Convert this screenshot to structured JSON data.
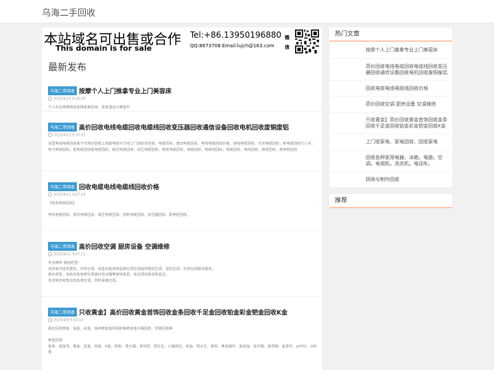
{
  "site": {
    "title": "乌海二手回收"
  },
  "banner": {
    "cn": "本站域名可出售或合作",
    "en": "This domain is for sale",
    "tel": "Tel:+86.13950196880",
    "contact": "QQ:8673708 Email:lujch@163.com",
    "wechat_label": "微信"
  },
  "section": {
    "title": "最新发布"
  },
  "posts": [
    {
      "category": "乌海二手回收",
      "title": "按摩个人上门推拿专业上门美容床",
      "date": "2025/4/13 9:20:39",
      "excerpt": "个人专业按摩椅回收推拿美容床，皮家酒店公寓首可"
    },
    {
      "category": "乌海二手回收",
      "title": "高价回收电线电缆回收电缆线回收变压器回收通信设备回收电机回收废铜废铝",
      "date": "2025/4/13 9:20:32",
      "excerpt": "全国电线电缆回收高于市场价回收工地废电缆平方线上门回收价回收，电缆回收，废旧电缆回收，电线电缆回收价格，通信电缆回收，光伏电缆回收，新电缆回收行八折，电力电缆回收，铝电缆回收铝电缆回收，高压电缆回收，低压电缆回收，带皮电缆回收，电缆回收，电缆线回收，电缆回收，电线回收，电缆回收，废电缆回收"
    },
    {
      "category": "乌海二手回收",
      "title": "回收电缆电线电缆线回收价格",
      "date": "2025/4/11 9:07:19",
      "excerpt": "【常态电缆回收】\n\n电线电缆回收、通讯电缆回收、高压电缆回收、控制电缆回收、变压器回收、配电柜回收。"
    },
    {
      "category": "乌海二手回收",
      "title": "高价回收空调 厨房设备 空调维修",
      "date": "2025/4/11 9:07:12",
      "excerpt": "专业维修 诚信经营！\n该将家可提供更的、中央空调、收售出售各种品牌空调空调提供租机空调、挂机空调、中央空调服务服务。\n高价收售、也给出售各种空调高价机冰箱等家电家具、有空调出售请收益业。\n本店常年收售出售各类空调，同时承接空调。"
    },
    {
      "category": "乌海二手回收",
      "title": "只收黄金】高价回收黄金首饰回收金条回收千足金回收铂金彩金钯金回收K金",
      "date": "2025/4/9 9:33:10",
      "excerpt": "高价回收黄金、铂金、彩金、各种黄金首饰回收等黄金金手镯回收、项链回收等\n\n黄金回收：\n金条、金首饰、黄金、足金、铂金、K金、钯金、周大福、老凤祥、周生生、六福珠宝、老庙、周大生、菜百、黄金摆件、金戒指、金手镯、金项链、金耳环、pt950、18K金"
    }
  ],
  "sidebar": {
    "hot_title": "热门文章",
    "hot_items": [
      "按摩个人上门推拿专业上门美容床",
      "高价回收电线电缆回收电缆线回收变压器回收通信设备回收电机回收废铜废铝",
      "回收电缆电线电缆线回收价格",
      "高价回收空调 厨房设备 空调维修",
      "只收黄金】高价回收黄金首饰回收金条回收千足金回收铂金彩金钯金回收K金",
      "上门收家电、家电回收、回收家电",
      "回收各种家用电器，冰箱，电脑，空调，电视机，洗衣机，电动车。",
      "拆除与制作回收"
    ],
    "rec_title": "推荐"
  },
  "colors": {
    "category_badge": "#3c9bd3",
    "widget_underline": "#ffc5a8",
    "background": "#f1f1f1"
  }
}
